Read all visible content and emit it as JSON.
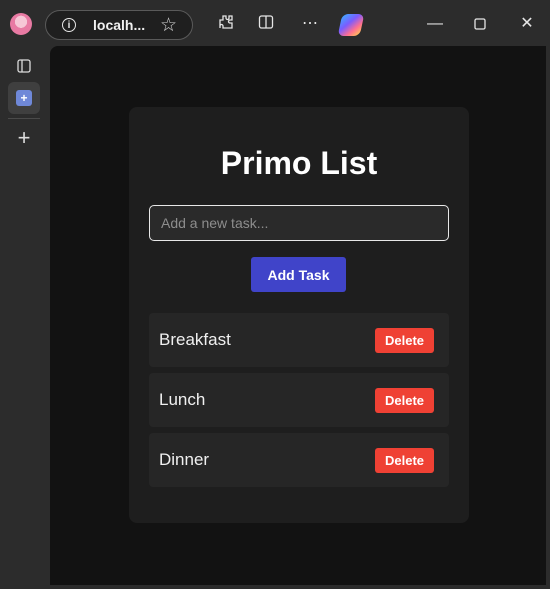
{
  "browser": {
    "url": "localh...",
    "icons": [
      "profile-avatar",
      "info-icon",
      "star-icon",
      "extensions-icon",
      "split-screen-icon",
      "more-icon",
      "copilot-icon",
      "minimize-icon",
      "maximize-icon",
      "close-icon"
    ],
    "sidebar_icons": [
      "tab-actions-icon",
      "tab-favicon",
      "new-tab-icon"
    ]
  },
  "app": {
    "title": "Primo List",
    "input_placeholder": "Add a new task...",
    "input_value": "",
    "add_button_label": "Add Task",
    "delete_label": "Delete",
    "tasks": [
      {
        "label": "Breakfast"
      },
      {
        "label": "Lunch"
      },
      {
        "label": "Dinner"
      }
    ]
  },
  "colors": {
    "accent": "#4044c9",
    "danger": "#ef4134",
    "background": "#121212",
    "card": "#1e1e1e"
  }
}
